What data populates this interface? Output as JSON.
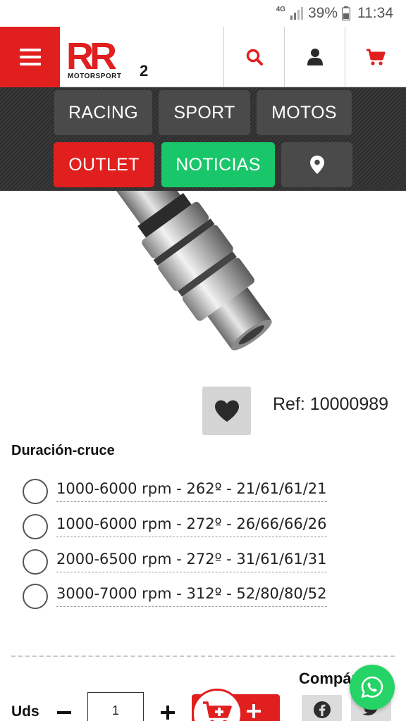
{
  "status_bar": {
    "network": "4G",
    "battery": "39%",
    "time": "11:34"
  },
  "header": {
    "logo": {
      "main": "RR",
      "sub": "MOTORSPORT",
      "mark": "2"
    },
    "icons": [
      "menu-icon",
      "search-icon",
      "user-icon",
      "cart-icon"
    ]
  },
  "nav": {
    "racing": "RACING",
    "sport": "SPORT",
    "motos": "MOTOS",
    "outlet": "OUTLET",
    "noticias": "NOTICIAS"
  },
  "product": {
    "ref": "Ref: 10000989"
  },
  "options": {
    "title": "Duración-cruce",
    "items": [
      "1000-6000 rpm - 262º - 21/61/61/21",
      "1000-6000 rpm - 272º - 26/66/66/26",
      "2000-6500 rpm - 272º - 31/61/61/31",
      "3000-7000 rpm - 312º - 52/80/80/52"
    ]
  },
  "purchase": {
    "uds_label": "Uds",
    "quantity": "1",
    "share_label": "Compártelo"
  },
  "colors": {
    "brand_red": "#e21f1f",
    "news_green": "#19c76a",
    "nav_gray": "#4a4a4a",
    "whatsapp_green": "#25d366"
  }
}
